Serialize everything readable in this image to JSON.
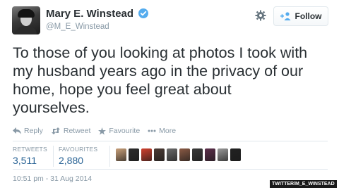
{
  "author": {
    "name": "Mary E. Winstead",
    "handle": "@M_E_Winstead",
    "verified": true
  },
  "follow_button": {
    "label": "Follow"
  },
  "tweet": {
    "lines": [
      "To those of you looking at photos I took with",
      "my husband years ago in the privacy of our",
      "home, hope you feel great about",
      "yourselves."
    ]
  },
  "actions": {
    "reply": "Reply",
    "retweet": "Retweet",
    "favourite": "Favourite",
    "more": "More"
  },
  "stats": {
    "retweets_label": "RETWEETS",
    "retweets_value": "3,511",
    "favourites_label": "FAVOURITES",
    "favourites_value": "2,880"
  },
  "favouriters": [
    {
      "icon": "faver-avatar",
      "color": "#c9a07a"
    },
    {
      "icon": "faver-avatar",
      "color": "#2c2c2c"
    },
    {
      "icon": "faver-avatar",
      "color": "#d0402e"
    },
    {
      "icon": "faver-avatar",
      "color": "#4b3b35"
    },
    {
      "icon": "faver-avatar",
      "color": "#6b6b6b"
    },
    {
      "icon": "faver-avatar",
      "color": "#8a5a44"
    },
    {
      "icon": "faver-avatar",
      "color": "#3a3a3a"
    },
    {
      "icon": "faver-avatar",
      "color": "#5c2e4a"
    },
    {
      "icon": "faver-avatar",
      "color": "#9a9a9a"
    },
    {
      "icon": "faver-avatar",
      "color": "#222222"
    }
  ],
  "timestamp": "10:51 pm - 31 Aug 2014",
  "watermark": "TWITTER/M_E_WINSTEAD",
  "colors": {
    "text": "#292f33",
    "muted": "#8899a6",
    "link": "#2a6496",
    "verified": "#55acee"
  }
}
